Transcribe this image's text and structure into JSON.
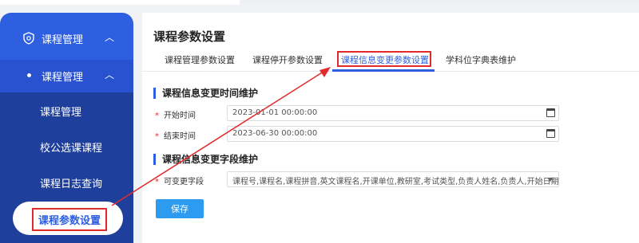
{
  "sidebar": {
    "group": "课程管理",
    "subgroup": "课程管理",
    "items": [
      "课程管理",
      "校公选课课程",
      "课程日志查询",
      "课程参数设置"
    ],
    "active_index": 3
  },
  "page": {
    "title": "课程参数设置",
    "tabs": [
      "课程管理参数设置",
      "课程停开参数设置",
      "课程信息变更参数设置",
      "学科位字典表维护"
    ],
    "active_tab": 2
  },
  "section1": {
    "title": "课程信息变更时间维护",
    "start_label": "开始时间",
    "start_value": "2023-01-01 00:00:00",
    "end_label": "结束时间",
    "end_value": "2023-06-30 00:00:00"
  },
  "section2": {
    "title": "课程信息变更字段维护",
    "fields_label": "可变更字段",
    "fields_value": "课程号,课程名,课程拼音,英文课程名,开课单位,教研室,考试类型,负责人姓名,负责人,开始日期,暂停..."
  },
  "actions": {
    "save_label": "保存"
  },
  "colors": {
    "accent": "#2d5fe0",
    "highlight": "#e12b2b",
    "button": "#2d9cf0"
  }
}
